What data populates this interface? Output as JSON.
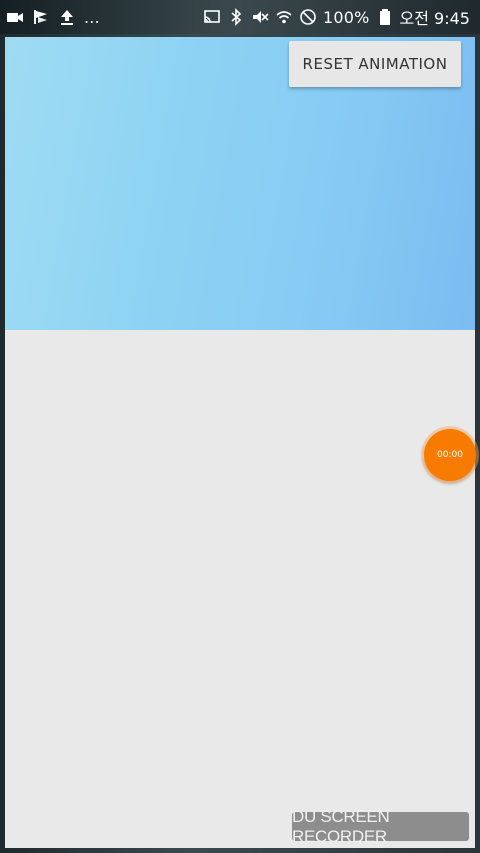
{
  "status_bar": {
    "overflow_indicator": "...",
    "battery_percent": "100%",
    "time": "오전 9:45",
    "left_icons": [
      "video-camera-icon",
      "flag-icon",
      "upload-icon"
    ],
    "right_icons": [
      "cast-icon",
      "bluetooth-icon",
      "mute-icon",
      "wifi-icon",
      "do-not-disturb-icon",
      "battery-icon"
    ]
  },
  "header": {
    "reset_button_label": "RESET ANIMATION"
  },
  "recorder_bubble": {
    "timer": "00:00",
    "color": "#f77b00"
  },
  "watermark": {
    "text": "DU SCREEN RECORDER"
  },
  "colors": {
    "header_gradient_start": "#9fdcf3",
    "header_gradient_end": "#7bbcf1",
    "content_background": "#e9e9ea"
  }
}
